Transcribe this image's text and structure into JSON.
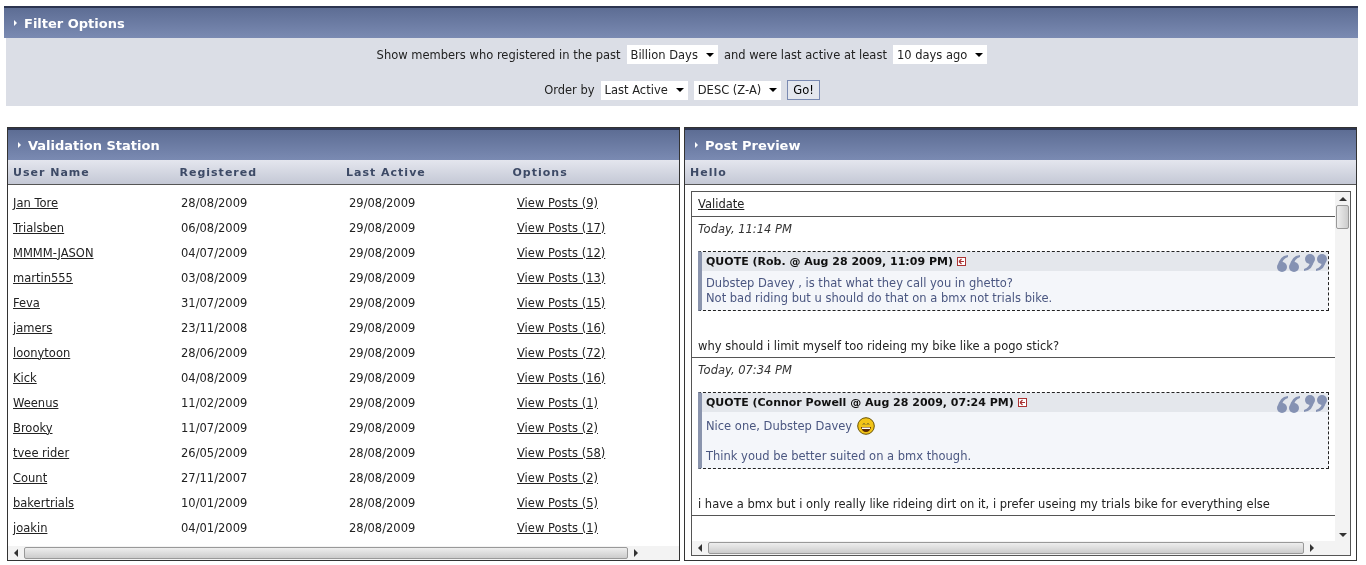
{
  "filter": {
    "title": "Filter Options",
    "registered_label": "Show members who registered in the past",
    "registered_select": "Billion Days",
    "active_label": "and were last active at least",
    "active_select": "10 days ago",
    "order_label": "Order by",
    "order_select": "Last Active",
    "direction_select": "DESC (Z-A)",
    "go_button": "Go!"
  },
  "validation": {
    "title": "Validation Station",
    "columns": [
      "User Name",
      "Registered",
      "Last Active",
      "Options"
    ],
    "rows": [
      {
        "user": "Jan Tore",
        "registered": "28/08/2009",
        "last_active": "29/08/2009",
        "options": "View Posts (9)"
      },
      {
        "user": "Trialsben",
        "registered": "06/08/2009",
        "last_active": "29/08/2009",
        "options": "View Posts (17)"
      },
      {
        "user": "MMMM-JASON",
        "registered": "04/07/2009",
        "last_active": "29/08/2009",
        "options": "View Posts (12)"
      },
      {
        "user": "martin555",
        "registered": "03/08/2009",
        "last_active": "29/08/2009",
        "options": "View Posts (13)"
      },
      {
        "user": "Feva",
        "registered": "31/07/2009",
        "last_active": "29/08/2009",
        "options": "View Posts (15)"
      },
      {
        "user": "jamers",
        "registered": "23/11/2008",
        "last_active": "29/08/2009",
        "options": "View Posts (16)"
      },
      {
        "user": "loonytoon",
        "registered": "28/06/2009",
        "last_active": "29/08/2009",
        "options": "View Posts (72)"
      },
      {
        "user": "Kick",
        "registered": "04/08/2009",
        "last_active": "29/08/2009",
        "options": "View Posts (16)"
      },
      {
        "user": "Weenus",
        "registered": "11/02/2009",
        "last_active": "29/08/2009",
        "options": "View Posts (1)"
      },
      {
        "user": "Brooky",
        "registered": "11/07/2009",
        "last_active": "29/08/2009",
        "options": "View Posts (2)"
      },
      {
        "user": "tvee rider",
        "registered": "26/05/2009",
        "last_active": "28/08/2009",
        "options": "View Posts (58)"
      },
      {
        "user": "Count",
        "registered": "27/11/2007",
        "last_active": "28/08/2009",
        "options": "View Posts (2)"
      },
      {
        "user": "bakertrials",
        "registered": "10/01/2009",
        "last_active": "28/08/2009",
        "options": "View Posts (5)"
      },
      {
        "user": "joakin",
        "registered": "04/01/2009",
        "last_active": "28/08/2009",
        "options": "View Posts (1)"
      }
    ]
  },
  "preview": {
    "title": "Post Preview",
    "subheader": "Hello",
    "validate_link": "Validate",
    "posts": [
      {
        "date": "Today, 11:14 PM",
        "quote": {
          "header": "QUOTE (Rob. @ Aug 28 2009, 11:09 PM)",
          "paragraphs": [
            [
              {
                "text": "Dubstep Davey , is that what they call you in ghetto?",
                "emoticon": false
              },
              {
                "text": "Not bad riding but u should do that on a bmx not trials bike.",
                "emoticon": false
              }
            ]
          ]
        },
        "body": "why should i limit myself too rideing my bike like a pogo stick?"
      },
      {
        "date": "Today, 07:34 PM",
        "quote": {
          "header": "QUOTE (Connor Powell @ Aug 28 2009, 07:24 PM)",
          "paragraphs": [
            [
              {
                "text": "Nice one, Dubstep Davey",
                "emoticon": true
              }
            ],
            [
              {
                "text": "Think youd be better suited on a bmx though.",
                "emoticon": false
              }
            ]
          ]
        },
        "body": "i have a bmx but i only really like rideing dirt on it, i prefer useing my trials bike for everything else"
      }
    ]
  }
}
